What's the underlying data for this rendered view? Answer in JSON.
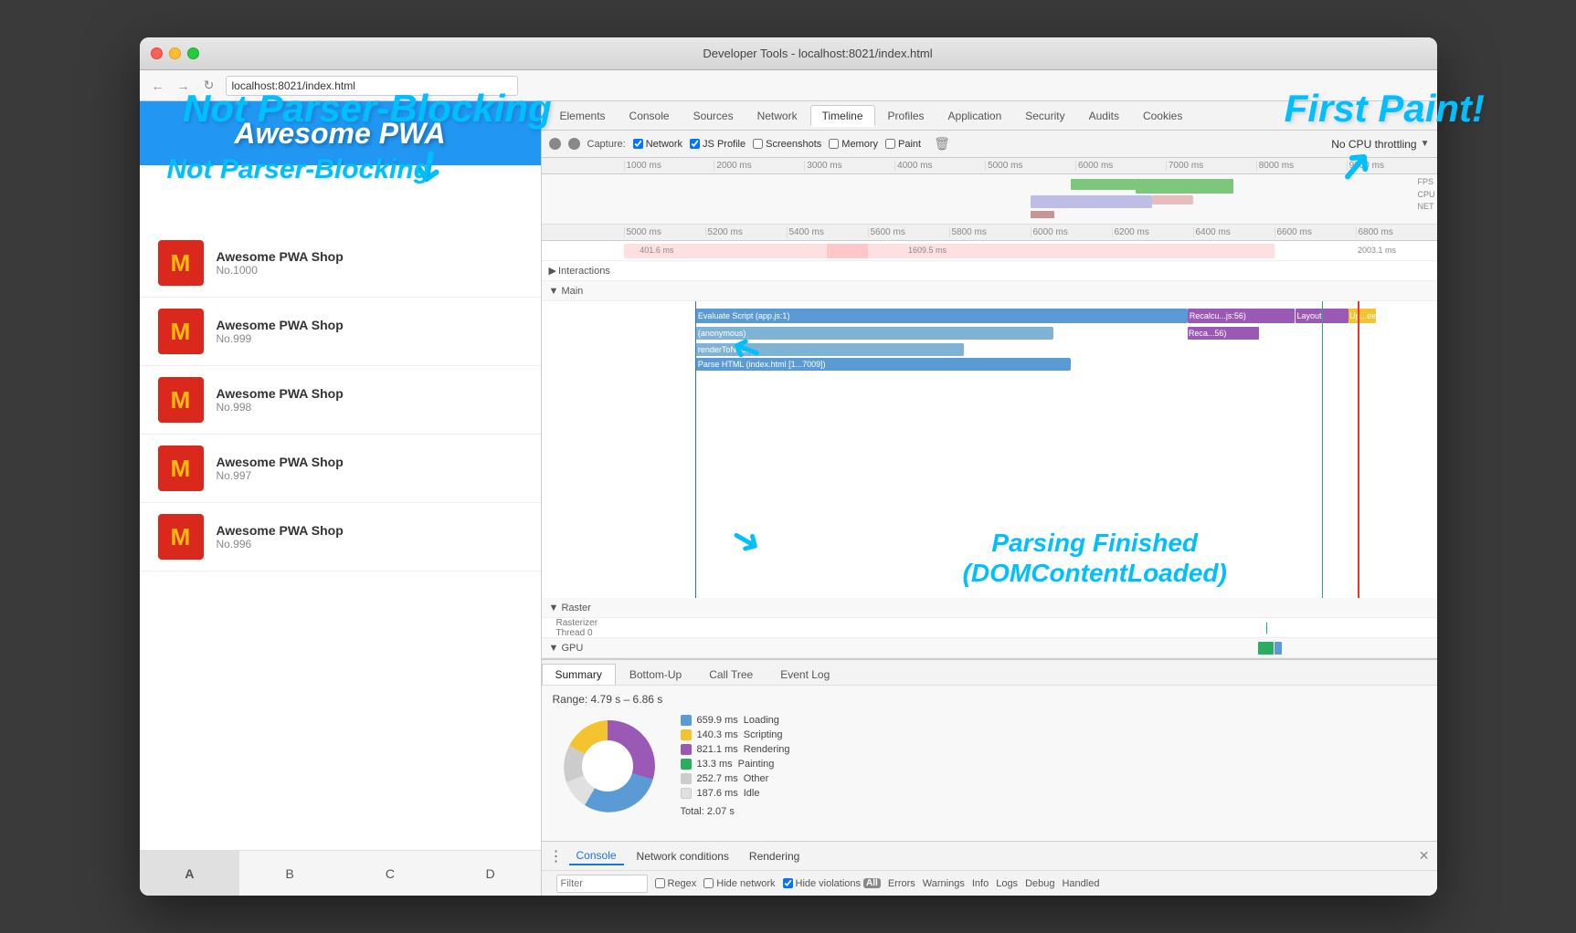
{
  "window": {
    "title": "Developer Tools - localhost:8021/index.html",
    "address": "localhost:8021/index.html"
  },
  "devtools_tabs": [
    {
      "label": "Elements",
      "active": false
    },
    {
      "label": "Console",
      "active": false
    },
    {
      "label": "Sources",
      "active": false
    },
    {
      "label": "Network",
      "active": false
    },
    {
      "label": "Timeline",
      "active": true
    },
    {
      "label": "Profiles",
      "active": false
    },
    {
      "label": "Application",
      "active": false
    },
    {
      "label": "Security",
      "active": false
    },
    {
      "label": "Audits",
      "active": false
    },
    {
      "label": "Cookies",
      "active": false
    }
  ],
  "toolbar": {
    "capture_label": "Capture:",
    "network_label": "Network",
    "js_profile_label": "JS Profile",
    "screenshots_label": "Screenshots",
    "memory_label": "Memory",
    "paint_label": "Paint",
    "cpu_throttle": "No CPU throttling"
  },
  "ruler_labels": [
    "1000 ms",
    "2000 ms",
    "3000 ms",
    "4000 ms",
    "5000 ms",
    "6000 ms",
    "7000 ms",
    "8000 ms",
    "9000 ms"
  ],
  "ruler_labels_2": [
    "5000 ms",
    "5200 ms",
    "5400 ms",
    "5600 ms",
    "5800 ms",
    "6000 ms",
    "6200 ms",
    "6400 ms",
    "6600 ms",
    "6800 ms"
  ],
  "timeline": {
    "interactions_label": "Interactions",
    "main_label": "▼ Main",
    "raster_label": "▼ Raster",
    "rasterizer_label": "Rasterizer Thread 0",
    "gpu_label": "▼ GPU",
    "timing_401": "401.6 ms",
    "timing_1609": "1609.5 ms",
    "timing_2003": "2003.1 ms",
    "evaluate_script": "Evaluate Script (app.js:1)",
    "anonymous": "(anonymous)",
    "render_to_node": "renderToNode",
    "parse_html": "Parse HTML (index.html [1...7009])",
    "recalculate": "Recalcu...js:56)",
    "layout": "Layout",
    "update": "Up...ee",
    "reca_56": "Reca...56)"
  },
  "annotations": {
    "not_parser_blocking": "Not Parser-Blocking",
    "first_paint": "First Paint!",
    "parsing_finished": "Parsing Finished\n(DOMContentLoaded)"
  },
  "bottom_panel": {
    "tabs": [
      "Summary",
      "Bottom-Up",
      "Call Tree",
      "Event Log"
    ],
    "active_tab": "Summary",
    "range_label": "Range: 4.79 s – 6.86 s",
    "total_label": "Total: 2.07 s",
    "legend": [
      {
        "label": "Loading",
        "value": "659.9 ms",
        "color": "#5b9bd5"
      },
      {
        "label": "Scripting",
        "value": "140.3 ms",
        "color": "#f4c430"
      },
      {
        "label": "Rendering",
        "value": "821.1 ms",
        "color": "#9b59b6"
      },
      {
        "label": "Painting",
        "value": "13.3 ms",
        "color": "#27ae60"
      },
      {
        "label": "Other",
        "value": "252.7 ms",
        "color": "#cccccc"
      },
      {
        "label": "Idle",
        "value": "187.6 ms",
        "color": "#ffffff"
      }
    ]
  },
  "console_bar": {
    "more_icon": "⋮",
    "tabs": [
      "Console",
      "Network conditions",
      "Rendering"
    ],
    "filter_placeholder": "Filter",
    "regex_label": "Regex",
    "hide_network_label": "Hide network",
    "hide_violations_label": "Hide violations",
    "all_badge": "All",
    "error_label": "Errors",
    "warnings_label": "Warnings",
    "info_label": "Info",
    "logs_label": "Logs",
    "debug_label": "Debug",
    "handled_label": "Handled"
  },
  "pwa": {
    "header_text": "Awesome PWA",
    "items": [
      {
        "name": "Awesome PWA Shop",
        "num": "No.1000"
      },
      {
        "name": "Awesome PWA Shop",
        "num": "No.999"
      },
      {
        "name": "Awesome PWA Shop",
        "num": "No.998"
      },
      {
        "name": "Awesome PWA Shop",
        "num": "No.997"
      },
      {
        "name": "Awesome PWA Shop",
        "num": "No.996"
      }
    ],
    "bottom_tabs": [
      {
        "label": "A",
        "active": true
      },
      {
        "label": "B",
        "active": false
      },
      {
        "label": "C",
        "active": false
      },
      {
        "label": "D",
        "active": false
      }
    ]
  }
}
